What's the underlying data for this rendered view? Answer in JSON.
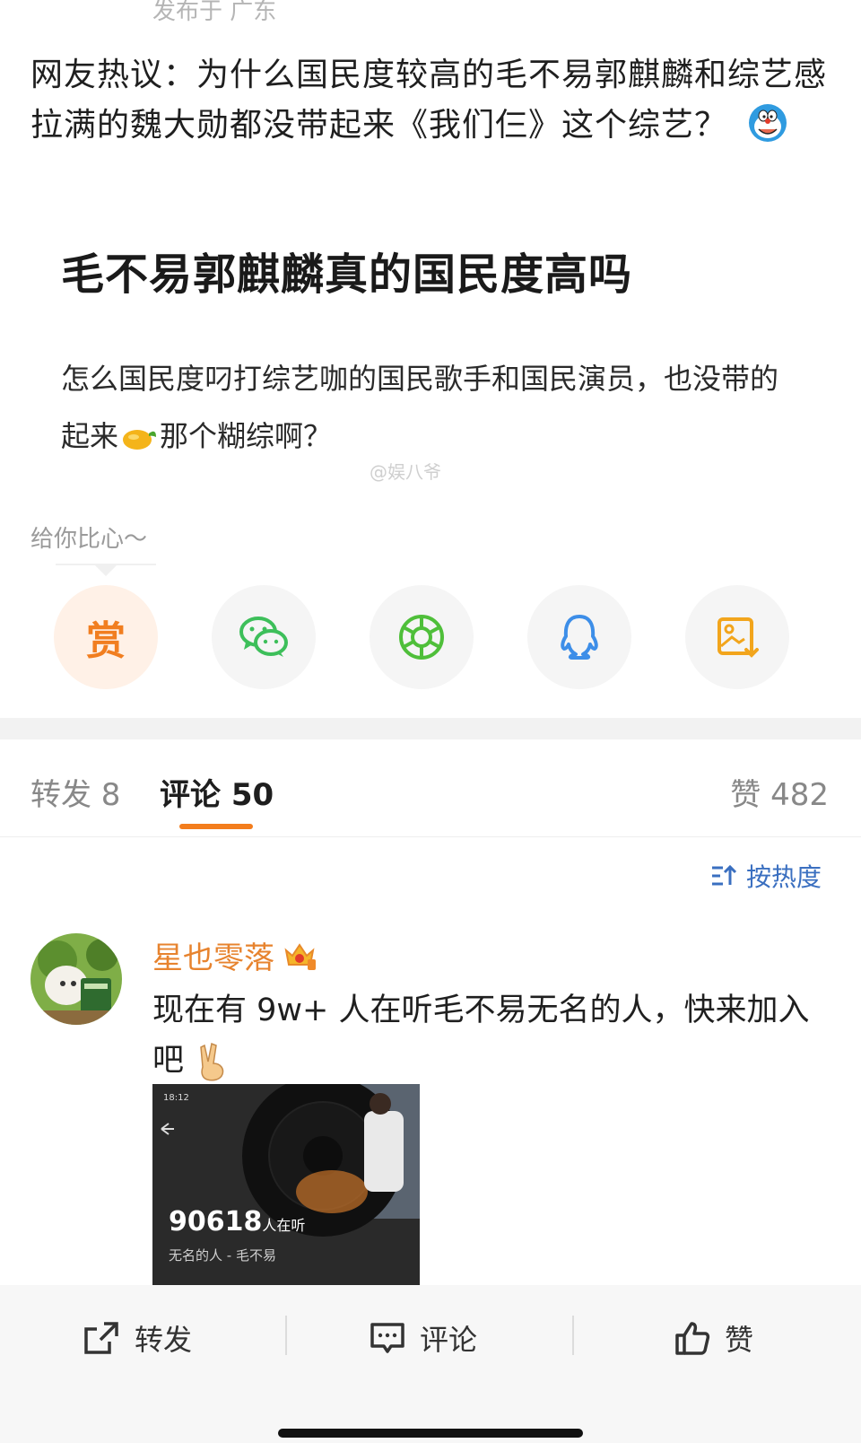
{
  "post": {
    "location": "发布于 广东",
    "text": "网友热议：为什么国民度较高的毛不易郭麒麟和综艺感拉满的魏大勋都没带起来《我们仨》这个综艺？",
    "image": {
      "title": "毛不易郭麒麟真的国民度高吗",
      "body_before": "怎么国民度叼打综艺咖的国民歌手和国民演员，也没带的起来",
      "body_after": "那个糊综啊？",
      "watermark": "@娱八爷"
    }
  },
  "tip": {
    "label": "给你比心～"
  },
  "share": {
    "reward_label": "赏",
    "items": [
      "reward",
      "wechat-icon",
      "moments-icon",
      "qq-icon",
      "save-image-icon"
    ]
  },
  "tabs": {
    "repost": "转发 8",
    "comment": "评论 50",
    "like": "赞 482"
  },
  "sort": {
    "label": "按热度"
  },
  "comment": {
    "user": "星也零落",
    "text": "现在有 9w+ 人在听毛不易无名的人，快来加入吧",
    "image": {
      "status_time": "18:12",
      "count": "90618",
      "count_suffix": "人在听",
      "song": "无名的人 - 毛不易"
    }
  },
  "bottom_bar": {
    "repost": "转发",
    "comment": "评论",
    "like": "赞"
  },
  "colors": {
    "accent": "#f37d1c",
    "username": "#e7832e",
    "link_blue": "#3a6fc0",
    "wechat_green": "#3dbf5a",
    "moments_green": "#4fbf3a",
    "qq_blue": "#3d8ee8",
    "save_orange": "#f2a51c"
  }
}
